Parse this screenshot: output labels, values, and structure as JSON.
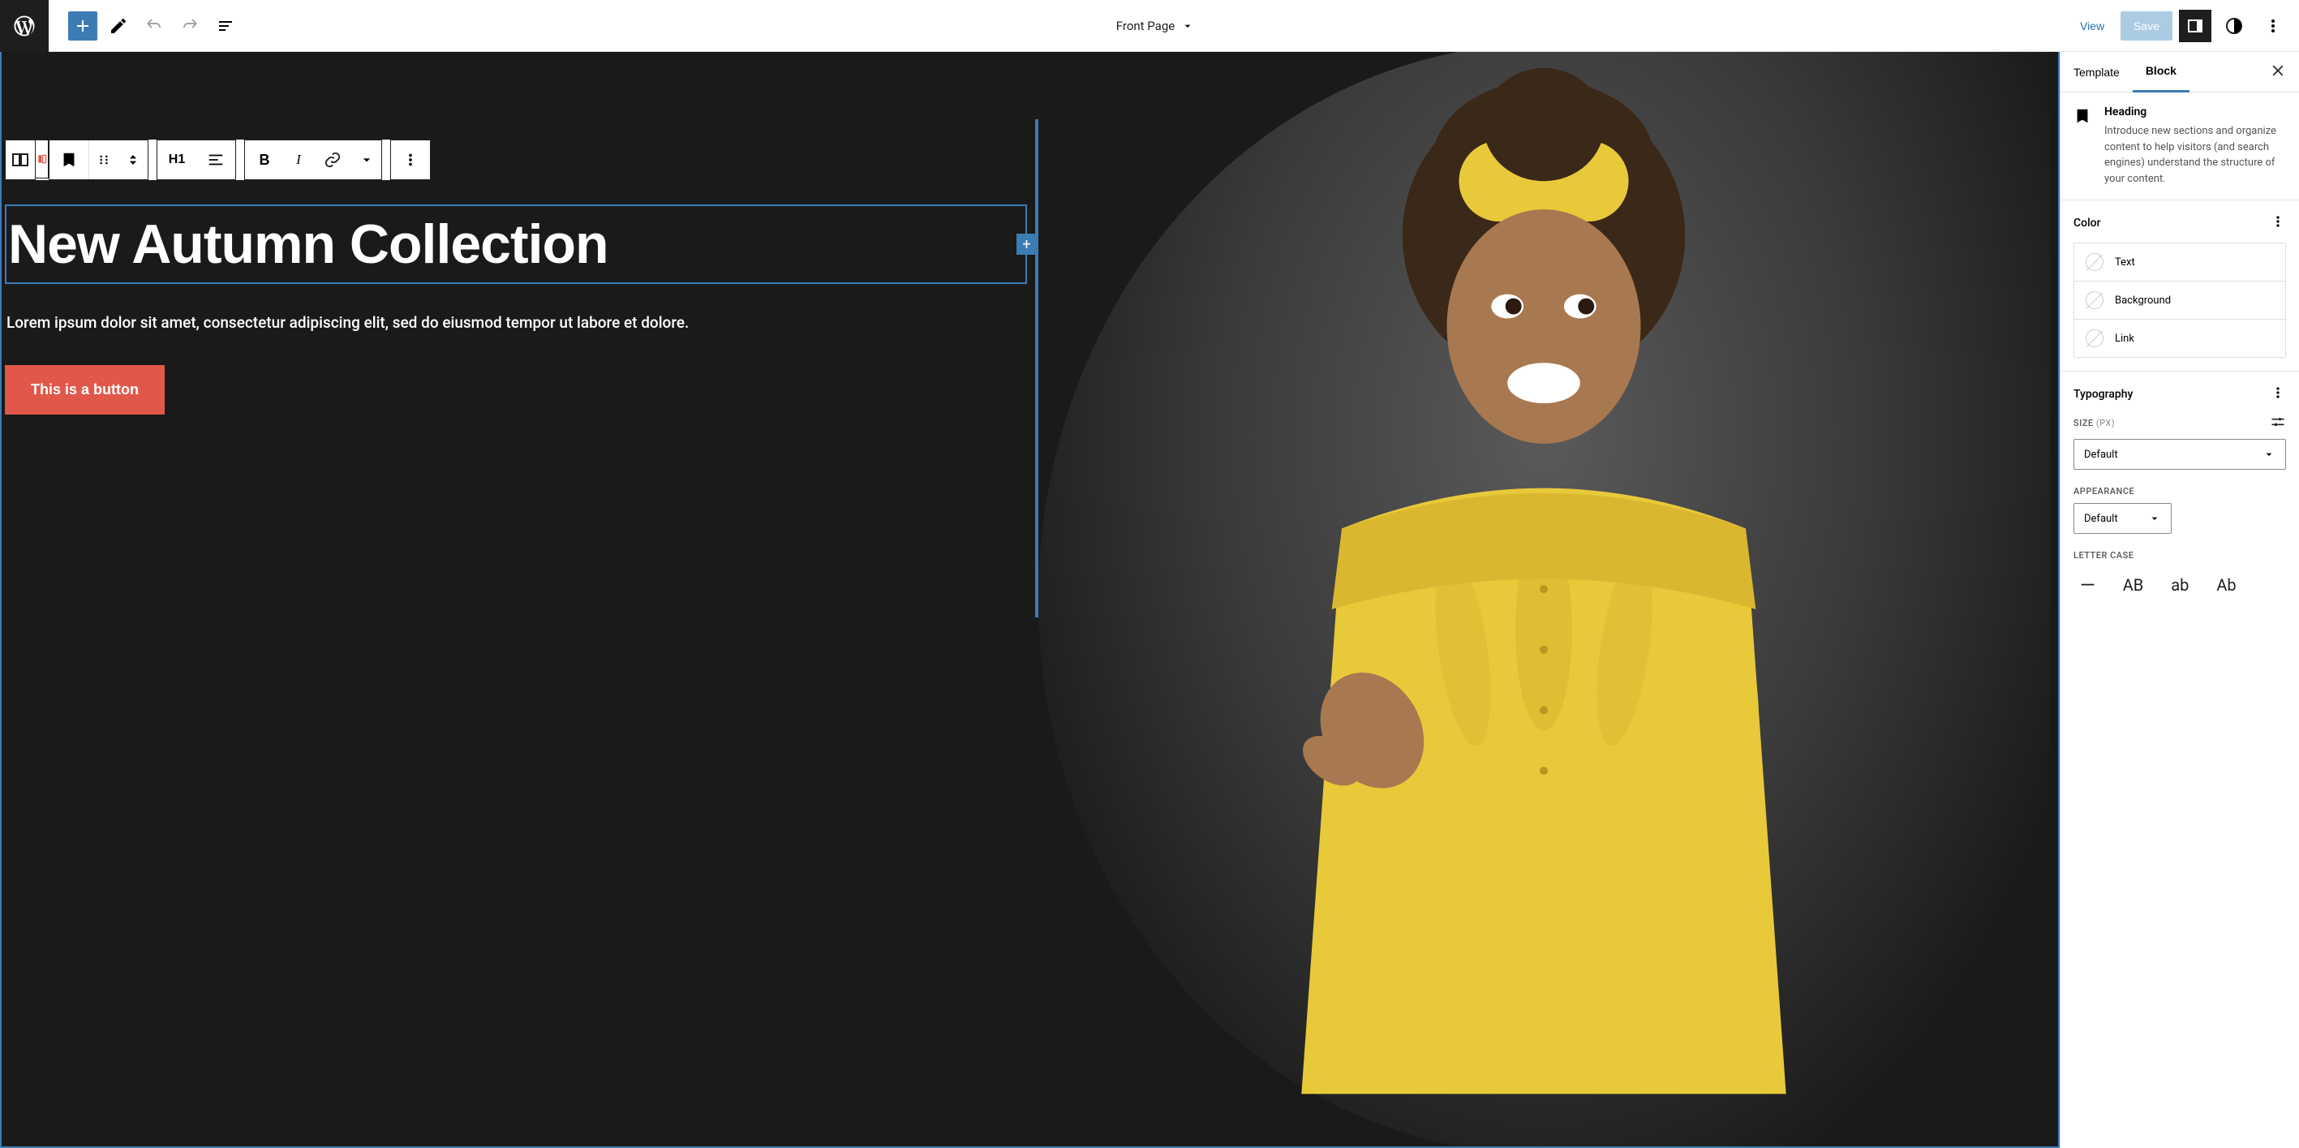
{
  "topbar": {
    "page_title": "Front Page",
    "view_label": "View",
    "save_label": "Save"
  },
  "block_toolbar": {
    "heading_level": "H1"
  },
  "canvas": {
    "heading": "New Autumn Collection",
    "paragraph": "Lorem ipsum dolor sit amet, consectetur adipiscing elit, sed do eiusmod tempor ut labore et dolore.",
    "button_label": "This is a button"
  },
  "sidebar": {
    "tabs": {
      "template": "Template",
      "block": "Block"
    },
    "block_info": {
      "title": "Heading",
      "description": "Introduce new sections and organize content to help visitors (and search engines) understand the structure of your content."
    },
    "color": {
      "title": "Color",
      "items": {
        "text": "Text",
        "background": "Background",
        "link": "Link"
      }
    },
    "typography": {
      "title": "Typography",
      "size_label": "SIZE",
      "size_unit": "(PX)",
      "size_value": "Default",
      "appearance_label": "APPEARANCE",
      "appearance_value": "Default",
      "letter_case_label": "LETTER CASE",
      "letter_cases": {
        "none": "—",
        "upper": "AB",
        "lower": "ab",
        "cap": "Ab"
      }
    }
  }
}
